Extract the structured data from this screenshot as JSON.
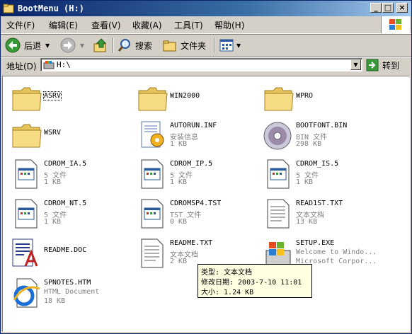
{
  "window": {
    "title": "BootMenu (H:)"
  },
  "menu": [
    "文件(F)",
    "编辑(E)",
    "查看(V)",
    "收藏(A)",
    "工具(T)",
    "帮助(H)"
  ],
  "toolbar": {
    "back_label": "后退",
    "search_label": "搜索",
    "folders_label": "文件夹"
  },
  "address": {
    "label": "地址(D)",
    "value": "H:\\",
    "go_label": "转到"
  },
  "items": [
    {
      "name": "ASRV",
      "type": "",
      "size": "",
      "icon": "folder-icon"
    },
    {
      "name": "WIN2000",
      "type": "",
      "size": "",
      "icon": "folder-icon"
    },
    {
      "name": "WPRO",
      "type": "",
      "size": "",
      "icon": "folder-icon"
    },
    {
      "name": "WSRV",
      "type": "",
      "size": "",
      "icon": "folder-icon"
    },
    {
      "name": "AUTORUN.INF",
      "type": "安装信息",
      "size": "1 KB",
      "icon": "setup-info-icon"
    },
    {
      "name": "BOOTFONT.BIN",
      "type": "BIN 文件",
      "size": "298 KB",
      "icon": "cd-icon"
    },
    {
      "name": "CDROM_IA.5",
      "type": "5 文件",
      "size": "1 KB",
      "icon": "file-icon"
    },
    {
      "name": "CDROM_IP.5",
      "type": "5 文件",
      "size": "1 KB",
      "icon": "file-icon"
    },
    {
      "name": "CDROM_IS.5",
      "type": "5 文件",
      "size": "1 KB",
      "icon": "file-icon"
    },
    {
      "name": "CDROM_NT.5",
      "type": "5 文件",
      "size": "1 KB",
      "icon": "file-icon"
    },
    {
      "name": "CDROMSP4.TST",
      "type": "TST 文件",
      "size": "0 KB",
      "icon": "file-icon"
    },
    {
      "name": "READ1ST.TXT",
      "type": "文本文档",
      "size": "13 KB",
      "icon": "text-doc-icon"
    },
    {
      "name": "README.DOC",
      "type": "",
      "size": "",
      "icon": "word-doc-icon"
    },
    {
      "name": "README.TXT",
      "type": "文本文档",
      "size": "2 KB",
      "icon": "text-doc-icon"
    },
    {
      "name": "SETUP.EXE",
      "type": "Welcome to Windo...",
      "size": "Microsoft Corpor...",
      "icon": "setup-exe-icon"
    },
    {
      "name": "SPNOTES.HTM",
      "type": "HTML Document",
      "size": "18 KB",
      "icon": "html-doc-icon"
    }
  ],
  "tooltip": {
    "line1": "类型: 文本文档",
    "line2": "修改日期: 2003-7-10 11:01",
    "line3": "大小: 1.24 KB"
  }
}
